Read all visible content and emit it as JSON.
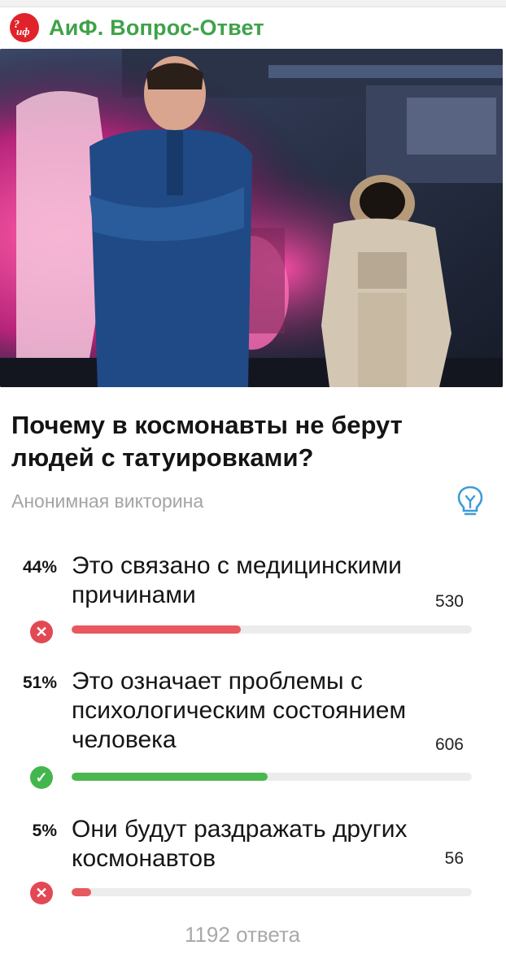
{
  "channel": {
    "logo_text": "АиФ",
    "name": "АиФ. Вопрос-Ответ"
  },
  "quiz": {
    "question": "Почему в космонавты не берут людей с татуировками?",
    "type_label": "Анонимная викторина",
    "hint_icon": "lightbulb-icon",
    "options": [
      {
        "percent_label": "44%",
        "percent": 44,
        "text": "Это связано с медицинскими причинами",
        "votes": "530",
        "result": "wrong"
      },
      {
        "percent_label": "51%",
        "percent": 51,
        "text": "Это означает проблемы с психологическим состоянием человека",
        "votes": "606",
        "result": "correct"
      },
      {
        "percent_label": "5%",
        "percent": 5,
        "text": "Они будут раздражать других космонавтов",
        "votes": "56",
        "result": "wrong"
      }
    ],
    "total": "1192 ответа"
  },
  "colors": {
    "channel_green": "#3fa24a",
    "wrong_red": "#e34855",
    "correct_green": "#43b64e",
    "track_gray": "#ececec"
  }
}
